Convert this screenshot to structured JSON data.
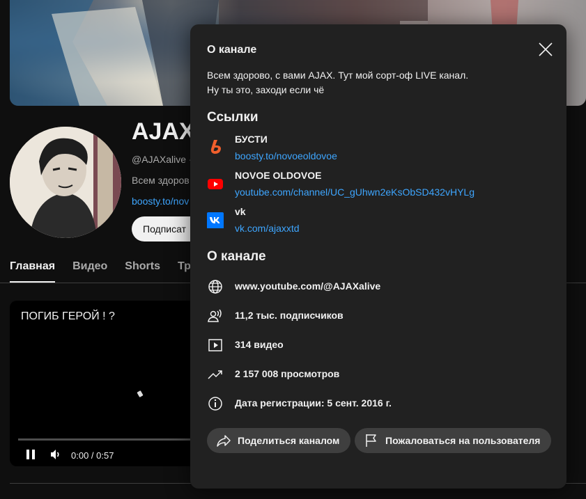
{
  "channel": {
    "title": "AJAX",
    "handle": "@AJAXalive ·",
    "desc_snippet": "Всем здоров",
    "link_snippet": "boosty.to/nov",
    "subscribe_label": "Подписат"
  },
  "tabs": [
    {
      "label": "Главная",
      "active": true
    },
    {
      "label": "Видео",
      "active": false
    },
    {
      "label": "Shorts",
      "active": false
    },
    {
      "label": "Тран",
      "active": false
    }
  ],
  "player": {
    "title": "ПОГИБ ГЕРОЙ ! ?",
    "time": "0:00 / 0:57"
  },
  "dialog": {
    "title": "О канале",
    "description": "Всем здорово, с вами AJAX. Тут мой сорт-оф LIVE канал.\nНу ты это, заходи если чё",
    "links_heading": "Ссылки",
    "links": [
      {
        "name": "БУСТИ",
        "url": "boosty.to/novoeoldovoe",
        "icon": "boosty-icon"
      },
      {
        "name": "NOVOE OLDOVOE",
        "url": "youtube.com/channel/UC_gUhwn2eKsObSD432vHYLg",
        "icon": "youtube-icon"
      },
      {
        "name": "vk",
        "url": "vk.com/ajaxxtd",
        "icon": "vk-icon"
      }
    ],
    "about_heading": "О канале",
    "info": [
      {
        "text": "www.youtube.com/@AJAXalive",
        "icon": "globe-icon"
      },
      {
        "text": "11,2 тыс. подписчиков",
        "icon": "subscribers-icon"
      },
      {
        "text": "314 видео",
        "icon": "video-icon"
      },
      {
        "text": "2 157 008 просмотров",
        "icon": "trending-icon"
      },
      {
        "text": "Дата регистрации: 5 сент. 2016 г.",
        "icon": "info-icon"
      }
    ],
    "share_label": "Поделиться каналом",
    "report_label": "Пожаловаться на пользователя"
  },
  "colors": {
    "background": "#0f0f0f",
    "dialog_bg": "#212121",
    "link_blue": "#3ea6ff",
    "youtube_red": "#ff0000",
    "boosty_orange": "#f15f2c",
    "vk_blue": "#0077ff"
  }
}
